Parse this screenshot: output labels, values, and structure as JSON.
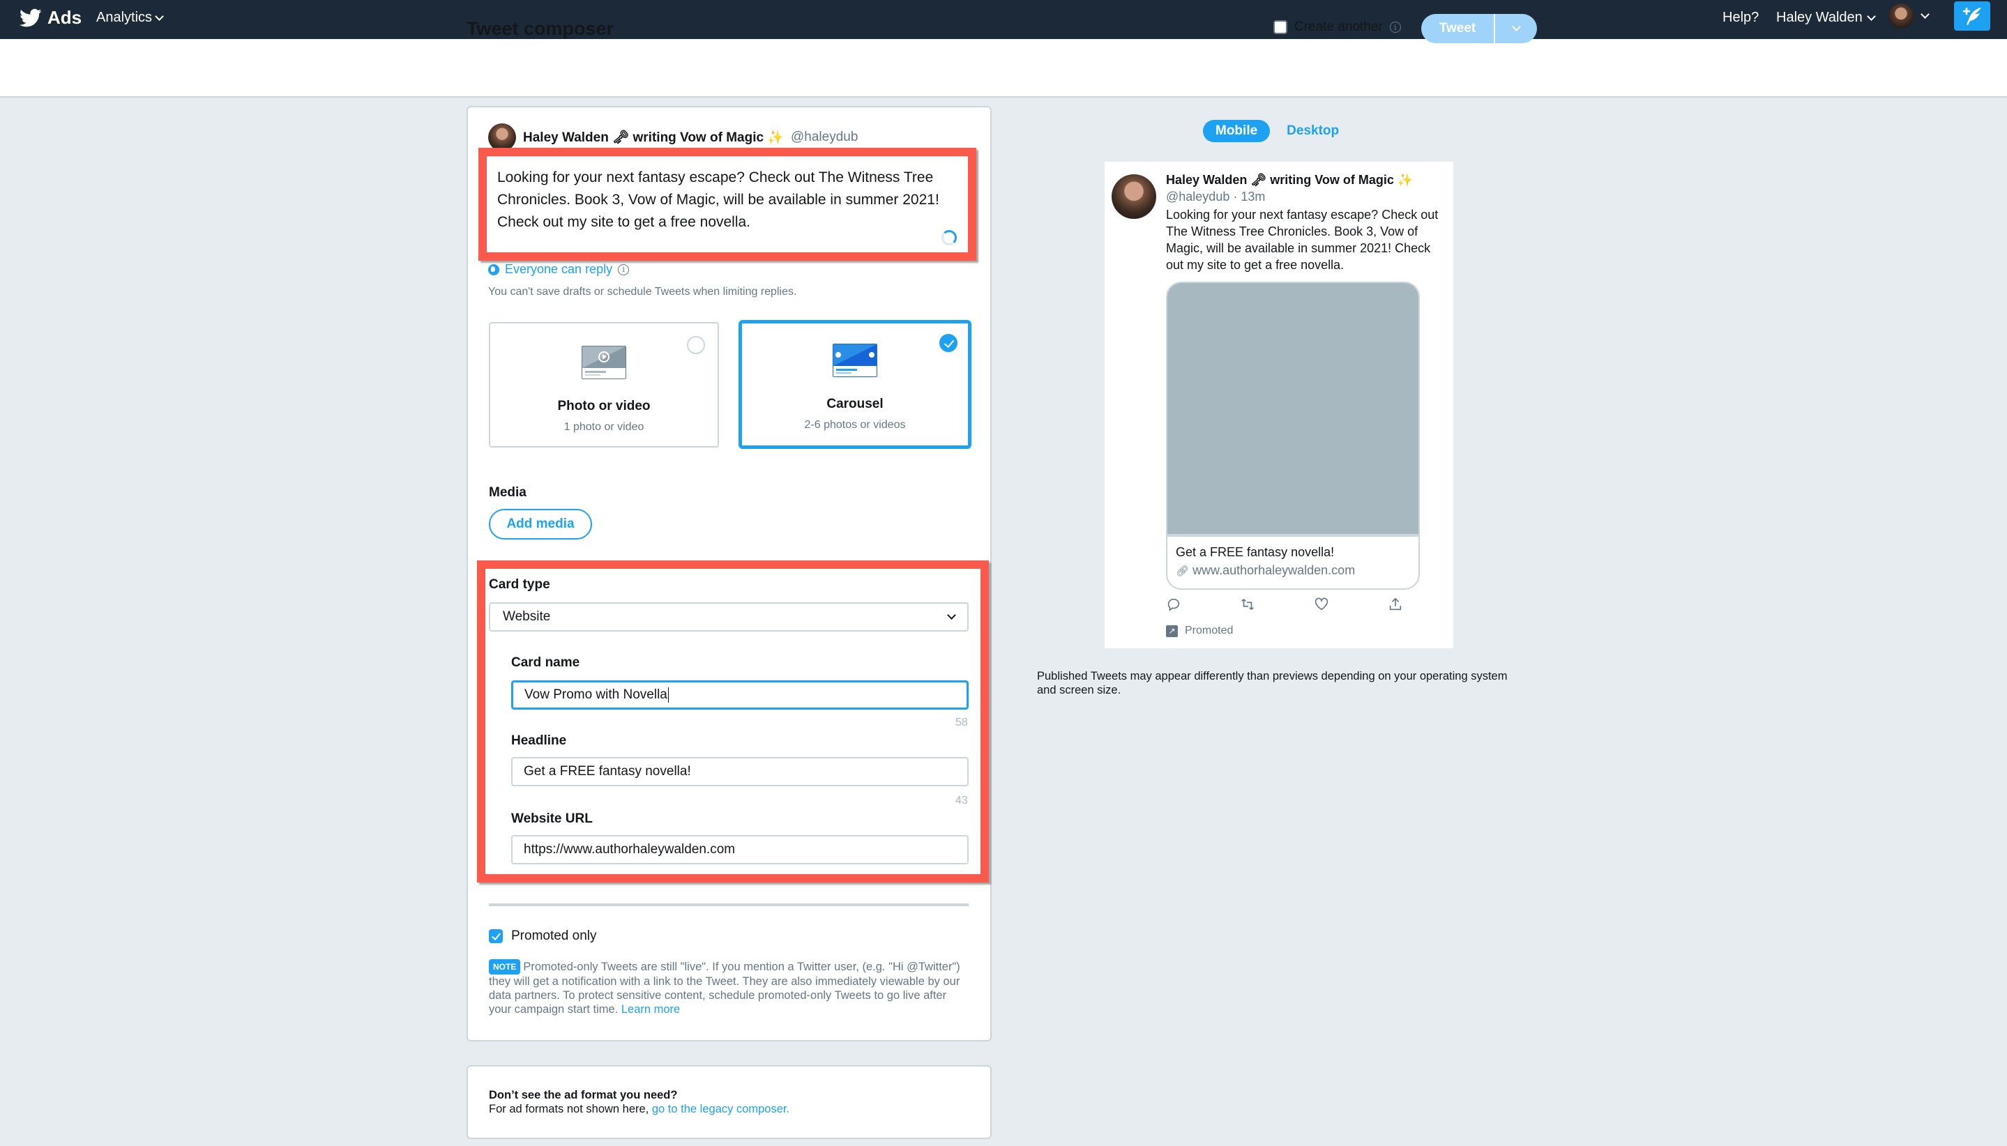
{
  "topbar": {
    "brand": "Ads",
    "analytics_label": "Analytics",
    "help_label": "Help?",
    "account_name": "Haley Walden",
    "icons": [
      "twitter-bird-icon",
      "chevron-down-icon",
      "avatar",
      "compose-tweet-icon"
    ]
  },
  "header": {
    "title": "Tweet composer",
    "create_another_label": "Create another",
    "create_another_checked": false,
    "tweet_button": "Tweet"
  },
  "composer": {
    "author_name": "Haley Walden 🗝 writing Vow of Magic ✨",
    "author_handle": "@haleydub",
    "tweet_text": "Looking for your next fantasy escape? Check out The Witness Tree Chronicles. Book 3, Vow of Magic, will be available in summer 2021! Check out my site to get a free novella.",
    "reply_setting": "Everyone can reply",
    "reply_note": "You can't save drafts or schedule Tweets when limiting replies.",
    "formats": [
      {
        "title": "Photo or video",
        "subtitle": "1 photo or video",
        "selected": false
      },
      {
        "title": "Carousel",
        "subtitle": "2-6 photos or videos",
        "selected": true
      }
    ],
    "media_label": "Media",
    "add_media_button": "Add media",
    "card_type_label": "Card type",
    "card_type_value": "Website",
    "card_name_label": "Card name",
    "card_name_value": "Vow Promo with Novella",
    "card_name_remaining": "58",
    "headline_label": "Headline",
    "headline_value": "Get a FREE fantasy novella!",
    "headline_remaining": "43",
    "website_url_label": "Website URL",
    "website_url_value": "https://www.authorhaleywalden.com",
    "promoted_only_label": "Promoted only",
    "promoted_only_checked": true,
    "note_badge": "NOTE",
    "note_text": "Promoted-only Tweets are still \"live\". If you mention a Twitter user, (e.g. \"Hi @Twitter\") they will get a notification with a link to the Tweet. They are also immediately viewable by our data partners. To protect sensitive content, schedule promoted-only Tweets to go live after your campaign start time.",
    "note_link": "Learn more"
  },
  "legacy": {
    "title": "Don’t see the ad format you need?",
    "text": "For ad formats not shown here, ",
    "link": "go to the legacy composer."
  },
  "preview": {
    "tabs": [
      {
        "label": "Mobile",
        "active": true
      },
      {
        "label": "Desktop",
        "active": false
      }
    ],
    "author_name": "Haley Walden 🗝 writing Vow of Magic ✨",
    "handle_time": "@haleydub · 13m",
    "text": "Looking for your next fantasy escape? Check out The Witness Tree Chronicles. Book 3, Vow of Magic, will be available in summer 2021! Check out my site to get a free novella.",
    "card_headline": "Get a FREE fantasy novella!",
    "card_url": "www.authorhaleywalden.com",
    "promoted_label": "Promoted",
    "disclaimer": "Published Tweets may appear differently than previews depending on your operating system and screen size."
  },
  "colors": {
    "accent": "#1da1f2",
    "topbar": "#1c2938",
    "background": "#e6ecf0",
    "highlight_box": "#fa5a4b",
    "muted_text": "#657786"
  }
}
